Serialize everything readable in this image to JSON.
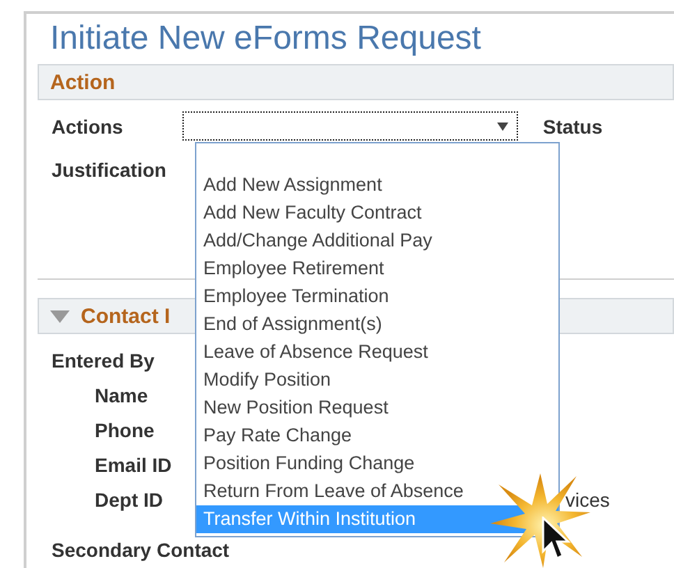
{
  "page": {
    "title": "Initiate New eForms Request"
  },
  "action_section": {
    "header": "Action",
    "actions_label": "Actions",
    "actions_select": {
      "expanded": true
    },
    "status_label": "Status",
    "justification_label": "Justification"
  },
  "dropdown": {
    "options": [
      {
        "label": "Add New Assignment",
        "selected": false
      },
      {
        "label": "Add New Faculty Contract",
        "selected": false
      },
      {
        "label": "Add/Change Additional Pay",
        "selected": false
      },
      {
        "label": "Employee Retirement",
        "selected": false
      },
      {
        "label": "Employee Termination",
        "selected": false
      },
      {
        "label": "End of Assignment(s)",
        "selected": false
      },
      {
        "label": "Leave of Absence Request",
        "selected": false
      },
      {
        "label": "Modify Position",
        "selected": false
      },
      {
        "label": "New Position Request",
        "selected": false
      },
      {
        "label": "Pay Rate Change",
        "selected": false
      },
      {
        "label": "Position Funding Change",
        "selected": false
      },
      {
        "label": "Return From Leave of Absence",
        "selected": false
      },
      {
        "label": "Transfer Within Institution",
        "selected": true
      }
    ]
  },
  "contact_section": {
    "header": "Contact I",
    "expanded": true,
    "entered_by_label": "Entered By",
    "fields": [
      {
        "label": "Name"
      },
      {
        "label": "Phone"
      },
      {
        "label": "Email ID"
      },
      {
        "label": "Dept ID",
        "value": "vices"
      }
    ],
    "secondary_contact_label": "Secondary Contact"
  }
}
